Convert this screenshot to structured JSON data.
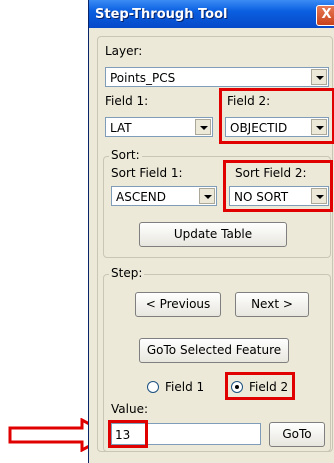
{
  "window": {
    "title": "Step-Through Tool",
    "close_glyph": "X"
  },
  "layer": {
    "label": "Layer:",
    "value": "Points_PCS"
  },
  "field1": {
    "label": "Field 1:",
    "value": "LAT"
  },
  "field2": {
    "label": "Field 2:",
    "value": "OBJECTID"
  },
  "sort": {
    "legend": "Sort:",
    "field1_label": "Sort Field 1:",
    "field1_value": "ASCEND",
    "field2_label": "Sort Field 2:",
    "field2_value": "NO SORT",
    "update_label": "Update Table"
  },
  "step": {
    "legend": "Step:",
    "previous_label": "< Previous",
    "next_label": "Next >",
    "goto_selected_label": "GoTo Selected Feature",
    "radio1_label": "Field 1",
    "radio2_label": "Field 2",
    "selected_radio": "Field 2"
  },
  "value": {
    "label": "Value:",
    "text": "13",
    "goto_label": "GoTo"
  },
  "annotation": {
    "arrow_color": "#e00000",
    "highlight_color": "#e00000"
  }
}
